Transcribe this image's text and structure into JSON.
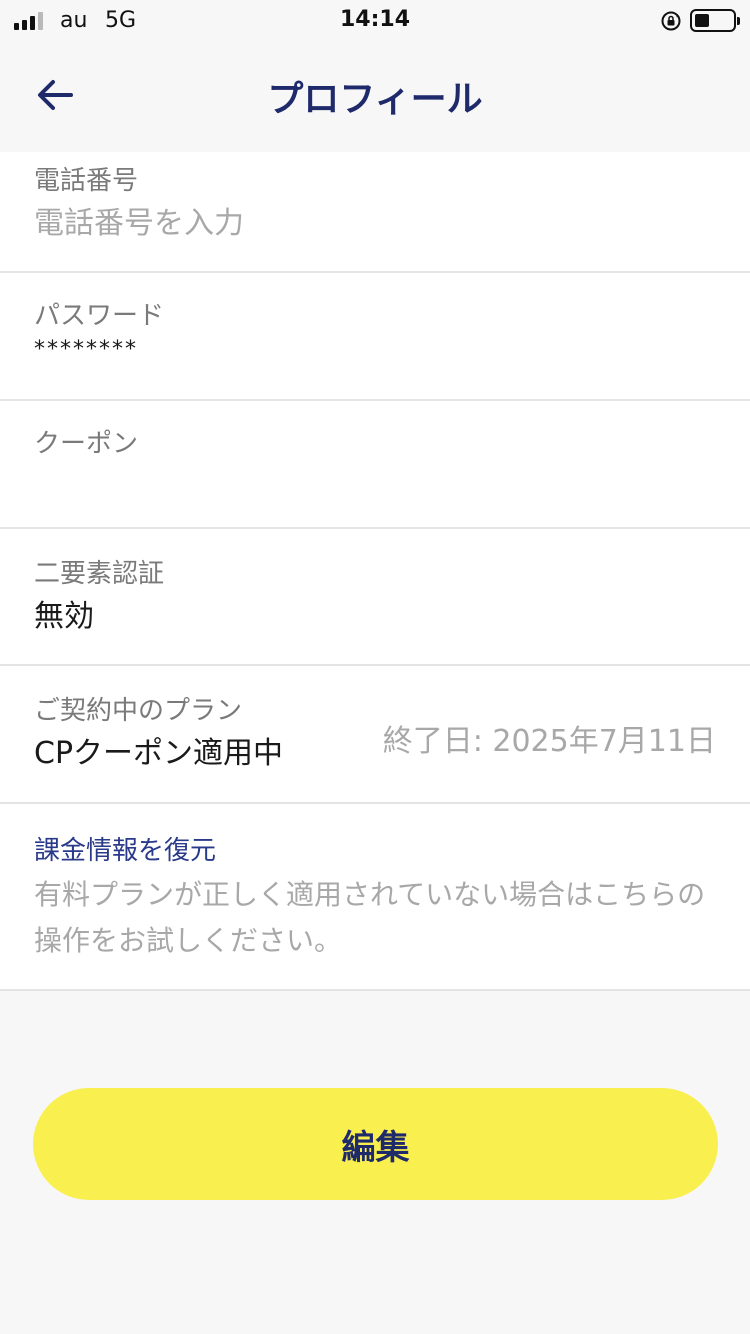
{
  "status_bar": {
    "carrier": "au",
    "network": "5G",
    "time": "14:14",
    "battery_level": 0.4
  },
  "header": {
    "title": "プロフィール",
    "back_icon": "arrow-left-icon"
  },
  "profile": {
    "phone": {
      "label": "電話番号",
      "placeholder": "電話番号を入力"
    },
    "password": {
      "label": "パスワード",
      "value": "********"
    },
    "coupon": {
      "label": "クーポン"
    },
    "two_factor": {
      "label": "二要素認証",
      "value": "無効"
    },
    "plan": {
      "label": "ご契約中のプラン",
      "value": "CPクーポン適用中",
      "end_date": "終了日: 2025年7月11日"
    },
    "restore": {
      "title": "課金情報を復元",
      "description": "有料プランが正しく適用されていない場合はこちらの操作をお試しください。"
    }
  },
  "actions": {
    "edit_label": "編集"
  },
  "colors": {
    "accent_navy": "#1f2a6b",
    "button_yellow": "#f9ef4f",
    "page_bg": "#f7f7f7"
  }
}
